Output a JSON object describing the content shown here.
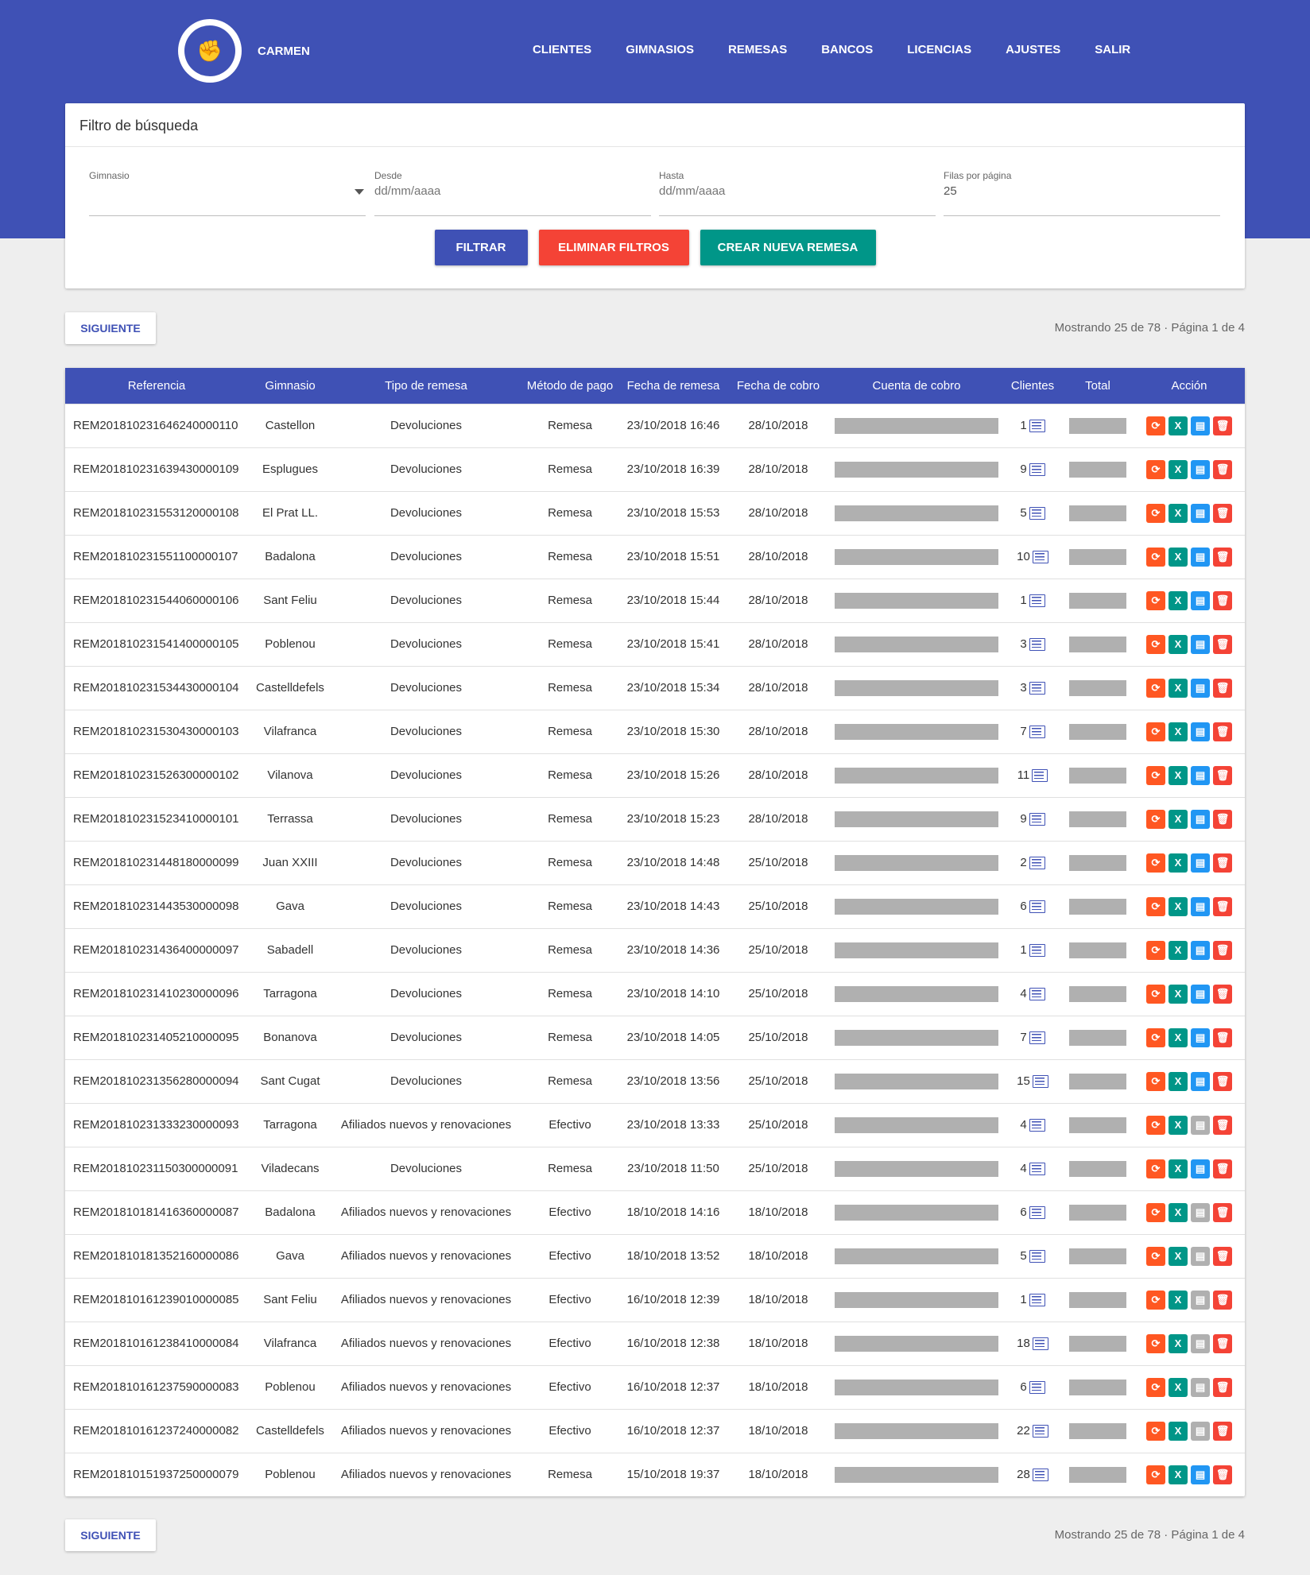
{
  "header": {
    "brand": "CARMEN",
    "logo_icon": "fist-logo-icon",
    "nav": [
      "CLIENTES",
      "GIMNASIOS",
      "REMESAS",
      "BANCOS",
      "LICENCIAS",
      "AJUSTES",
      "SALIR"
    ]
  },
  "filter": {
    "title": "Filtro de búsqueda",
    "gimnasio_label": "Gimnasio",
    "gimnasio_value": "",
    "desde_label": "Desde",
    "desde_placeholder": "dd/mm/aaaa",
    "hasta_label": "Hasta",
    "hasta_placeholder": "dd/mm/aaaa",
    "filas_label": "Filas por página",
    "filas_value": "25",
    "btn_filtrar": "FILTRAR",
    "btn_eliminar": "ELIMINAR FILTROS",
    "btn_crear": "CREAR NUEVA REMESA"
  },
  "pager": {
    "next_label": "SIGUIENTE",
    "status": "Mostrando 25 de 78 · Página 1 de 4"
  },
  "table": {
    "columns": [
      "Referencia",
      "Gimnasio",
      "Tipo de remesa",
      "Método de pago",
      "Fecha de remesa",
      "Fecha de cobro",
      "Cuenta de cobro",
      "Clientes",
      "Total",
      "Acción"
    ],
    "rows": [
      {
        "ref": "REM20181023164624000011​0",
        "gym": "Castellon",
        "tipo": "Devoluciones",
        "metodo": "Remesa",
        "fecha": "23/10/2018 16:46",
        "cobro": "28/10/2018",
        "clientes": "1",
        "pdf_enabled": true
      },
      {
        "ref": "REM201810231639430000109",
        "gym": "Esplugues",
        "tipo": "Devoluciones",
        "metodo": "Remesa",
        "fecha": "23/10/2018 16:39",
        "cobro": "28/10/2018",
        "clientes": "9",
        "pdf_enabled": true
      },
      {
        "ref": "REM201810231553120000108",
        "gym": "El Prat LL.",
        "tipo": "Devoluciones",
        "metodo": "Remesa",
        "fecha": "23/10/2018 15:53",
        "cobro": "28/10/2018",
        "clientes": "5",
        "pdf_enabled": true
      },
      {
        "ref": "REM201810231551100000107",
        "gym": "Badalona",
        "tipo": "Devoluciones",
        "metodo": "Remesa",
        "fecha": "23/10/2018 15:51",
        "cobro": "28/10/2018",
        "clientes": "10",
        "pdf_enabled": true
      },
      {
        "ref": "REM201810231544060000106",
        "gym": "Sant Feliu",
        "tipo": "Devoluciones",
        "metodo": "Remesa",
        "fecha": "23/10/2018 15:44",
        "cobro": "28/10/2018",
        "clientes": "1",
        "pdf_enabled": true
      },
      {
        "ref": "REM201810231541400000105",
        "gym": "Poblenou",
        "tipo": "Devoluciones",
        "metodo": "Remesa",
        "fecha": "23/10/2018 15:41",
        "cobro": "28/10/2018",
        "clientes": "3",
        "pdf_enabled": true
      },
      {
        "ref": "REM201810231534430000104",
        "gym": "Castelldefels",
        "tipo": "Devoluciones",
        "metodo": "Remesa",
        "fecha": "23/10/2018 15:34",
        "cobro": "28/10/2018",
        "clientes": "3",
        "pdf_enabled": true
      },
      {
        "ref": "REM201810231530430000103",
        "gym": "Vilafranca",
        "tipo": "Devoluciones",
        "metodo": "Remesa",
        "fecha": "23/10/2018 15:30",
        "cobro": "28/10/2018",
        "clientes": "7",
        "pdf_enabled": true
      },
      {
        "ref": "REM201810231526300000102",
        "gym": "Vilanova",
        "tipo": "Devoluciones",
        "metodo": "Remesa",
        "fecha": "23/10/2018 15:26",
        "cobro": "28/10/2018",
        "clientes": "11",
        "pdf_enabled": true
      },
      {
        "ref": "REM201810231523410000101",
        "gym": "Terrassa",
        "tipo": "Devoluciones",
        "metodo": "Remesa",
        "fecha": "23/10/2018 15:23",
        "cobro": "28/10/2018",
        "clientes": "9",
        "pdf_enabled": true
      },
      {
        "ref": "REM201810231448180000099",
        "gym": "Juan XXIII",
        "tipo": "Devoluciones",
        "metodo": "Remesa",
        "fecha": "23/10/2018 14:48",
        "cobro": "25/10/2018",
        "clientes": "2",
        "pdf_enabled": true
      },
      {
        "ref": "REM201810231443530000098",
        "gym": "Gava",
        "tipo": "Devoluciones",
        "metodo": "Remesa",
        "fecha": "23/10/2018 14:43",
        "cobro": "25/10/2018",
        "clientes": "6",
        "pdf_enabled": true
      },
      {
        "ref": "REM201810231436400000097",
        "gym": "Sabadell",
        "tipo": "Devoluciones",
        "metodo": "Remesa",
        "fecha": "23/10/2018 14:36",
        "cobro": "25/10/2018",
        "clientes": "1",
        "pdf_enabled": true
      },
      {
        "ref": "REM201810231410230000096",
        "gym": "Tarragona",
        "tipo": "Devoluciones",
        "metodo": "Remesa",
        "fecha": "23/10/2018 14:10",
        "cobro": "25/10/2018",
        "clientes": "4",
        "pdf_enabled": true
      },
      {
        "ref": "REM201810231405210000095",
        "gym": "Bonanova",
        "tipo": "Devoluciones",
        "metodo": "Remesa",
        "fecha": "23/10/2018 14:05",
        "cobro": "25/10/2018",
        "clientes": "7",
        "pdf_enabled": true
      },
      {
        "ref": "REM201810231356280000094",
        "gym": "Sant Cugat",
        "tipo": "Devoluciones",
        "metodo": "Remesa",
        "fecha": "23/10/2018 13:56",
        "cobro": "25/10/2018",
        "clientes": "15",
        "pdf_enabled": true
      },
      {
        "ref": "REM201810231333230000093",
        "gym": "Tarragona",
        "tipo": "Afiliados nuevos y renovaciones",
        "metodo": "Efectivo",
        "fecha": "23/10/2018 13:33",
        "cobro": "25/10/2018",
        "clientes": "4",
        "pdf_enabled": false
      },
      {
        "ref": "REM201810231150300000091",
        "gym": "Viladecans",
        "tipo": "Devoluciones",
        "metodo": "Remesa",
        "fecha": "23/10/2018 11:50",
        "cobro": "25/10/2018",
        "clientes": "4",
        "pdf_enabled": true
      },
      {
        "ref": "REM201810181416360000087",
        "gym": "Badalona",
        "tipo": "Afiliados nuevos y renovaciones",
        "metodo": "Efectivo",
        "fecha": "18/10/2018 14:16",
        "cobro": "18/10/2018",
        "clientes": "6",
        "pdf_enabled": false
      },
      {
        "ref": "REM201810181352160000086",
        "gym": "Gava",
        "tipo": "Afiliados nuevos y renovaciones",
        "metodo": "Efectivo",
        "fecha": "18/10/2018 13:52",
        "cobro": "18/10/2018",
        "clientes": "5",
        "pdf_enabled": false
      },
      {
        "ref": "REM201810161239010000085",
        "gym": "Sant Feliu",
        "tipo": "Afiliados nuevos y renovaciones",
        "metodo": "Efectivo",
        "fecha": "16/10/2018 12:39",
        "cobro": "18/10/2018",
        "clientes": "1",
        "pdf_enabled": false
      },
      {
        "ref": "REM201810161238410000084",
        "gym": "Vilafranca",
        "tipo": "Afiliados nuevos y renovaciones",
        "metodo": "Efectivo",
        "fecha": "16/10/2018 12:38",
        "cobro": "18/10/2018",
        "clientes": "18",
        "pdf_enabled": false
      },
      {
        "ref": "REM201810161237590000083",
        "gym": "Poblenou",
        "tipo": "Afiliados nuevos y renovaciones",
        "metodo": "Efectivo",
        "fecha": "16/10/2018 12:37",
        "cobro": "18/10/2018",
        "clientes": "6",
        "pdf_enabled": false
      },
      {
        "ref": "REM201810161237240000082",
        "gym": "Castelldefels",
        "tipo": "Afiliados nuevos y renovaciones",
        "metodo": "Efectivo",
        "fecha": "16/10/2018 12:37",
        "cobro": "18/10/2018",
        "clientes": "22",
        "pdf_enabled": false
      },
      {
        "ref": "REM201810151937250000079",
        "gym": "Poblenou",
        "tipo": "Afiliados nuevos y renovaciones",
        "metodo": "Remesa",
        "fecha": "15/10/2018 19:37",
        "cobro": "18/10/2018",
        "clientes": "28",
        "pdf_enabled": true
      }
    ]
  },
  "colors": {
    "primary": "#3f51b5",
    "danger": "#f44336",
    "teal": "#009688",
    "orange": "#ff5722",
    "blue": "#2196f3",
    "disabled": "#b0b0b0"
  },
  "action_icons": [
    "refresh-icon",
    "excel-icon",
    "file-icon",
    "trash-icon"
  ]
}
